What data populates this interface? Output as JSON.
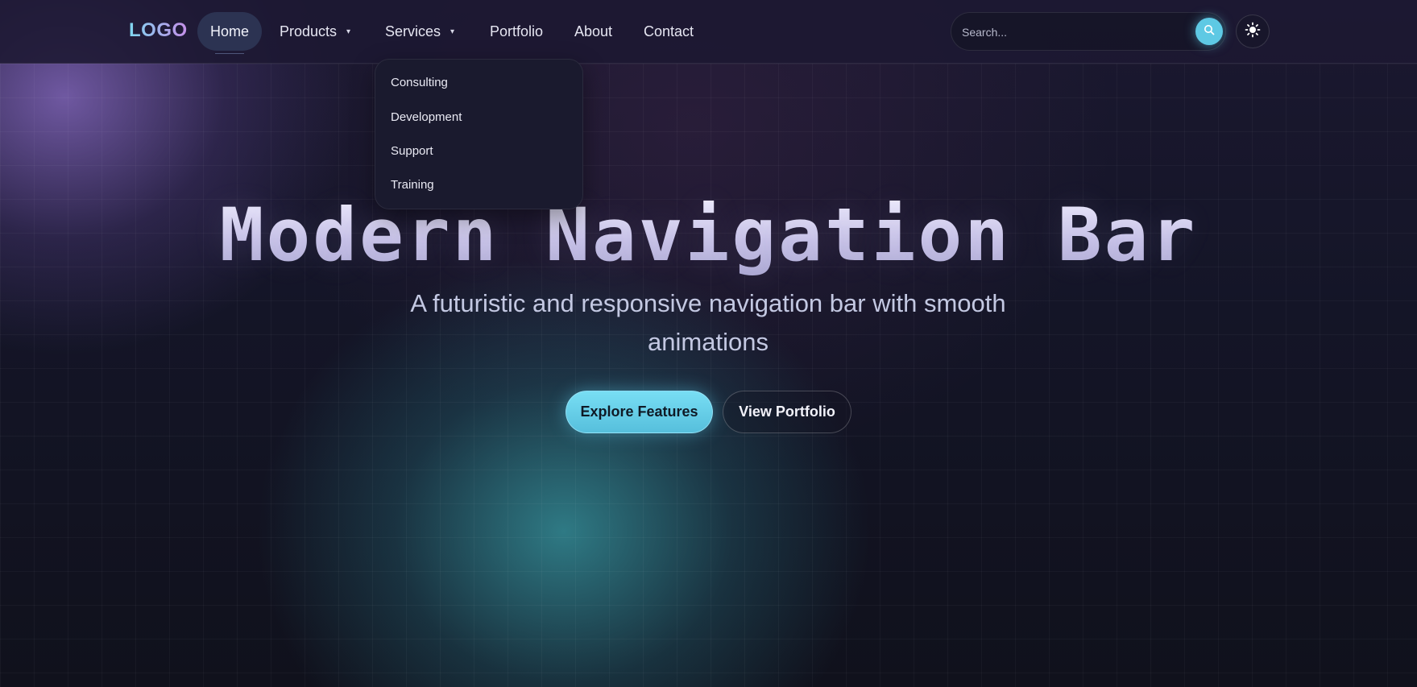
{
  "nav": {
    "logo": "LOGO",
    "items": [
      {
        "label": "Home",
        "active": true
      },
      {
        "label": "Products",
        "has_dropdown": true
      },
      {
        "label": "Services",
        "has_dropdown": true
      },
      {
        "label": "Portfolio"
      },
      {
        "label": "About"
      },
      {
        "label": "Contact"
      }
    ],
    "caret_icon": "chevron-down-icon"
  },
  "search": {
    "placeholder": "Search...",
    "value": "",
    "icon": "search-icon"
  },
  "theme_toggle": {
    "icon": "sun-icon"
  },
  "dropdown": {
    "items": [
      "Consulting",
      "Development",
      "Support",
      "Training"
    ]
  },
  "hero": {
    "title": "Modern Navigation Bar",
    "subtitle": "A futuristic and responsive navigation bar with smooth animations",
    "primary_button": "Explore Features",
    "secondary_button": "View Portfolio"
  },
  "colors": {
    "accent": "#5ec9e4",
    "background": "#11121f",
    "nav_background": "#1c1832",
    "active_pill": "#2c3352",
    "dropdown_background": "#1a1a2e"
  }
}
